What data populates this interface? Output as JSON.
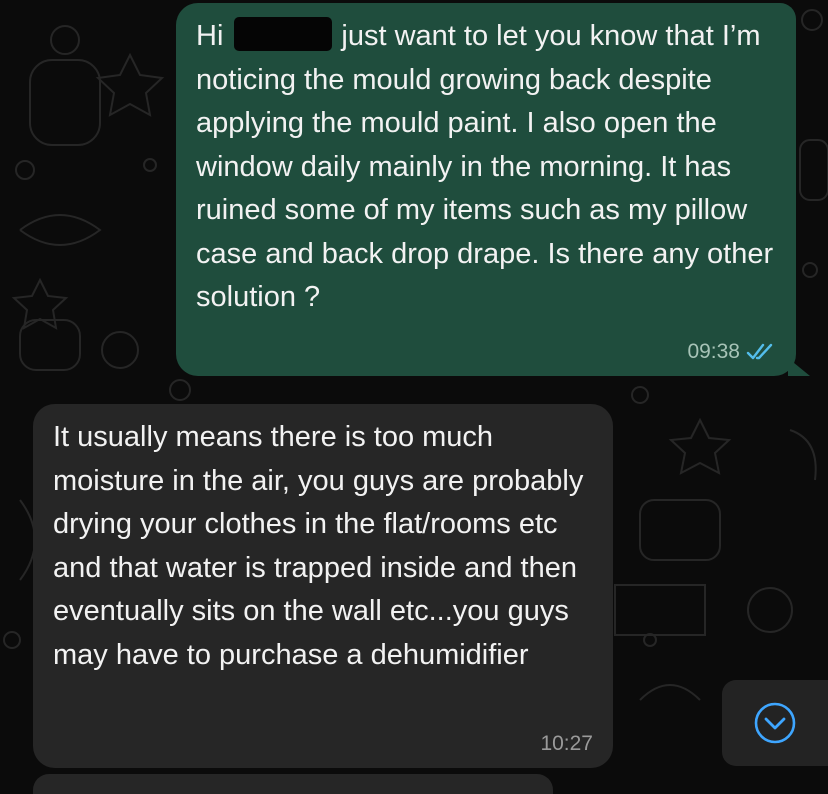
{
  "chat": {
    "messages": [
      {
        "direction": "outgoing",
        "text_before_redaction": "Hi",
        "text_after_redaction": "just want to let you know that I’m noticing the mould growing back despite applying the mould paint. I also open the window daily mainly in the morning. It has ruined some of my items such as my pillow case and back drop drape. Is there any other solution ?",
        "time": "09:38",
        "status": "read"
      },
      {
        "direction": "incoming",
        "text": "It usually means there is too much moisture in the air, you guys are probably drying your clothes in the flat/rooms etc and that water is trapped inside and then eventually sits on the wall etc...you guys may have to purchase a dehumidifier",
        "time": "10:27"
      }
    ],
    "colors": {
      "background": "#0b0b0b",
      "outgoing_bubble": "#1f4d3d",
      "incoming_bubble": "#262626",
      "read_ticks": "#53bdeb",
      "scroll_button_icon": "#3ea6ff"
    },
    "icons": {
      "read_status": "double-check-icon",
      "scroll_down": "chevron-down-circle-icon"
    }
  }
}
